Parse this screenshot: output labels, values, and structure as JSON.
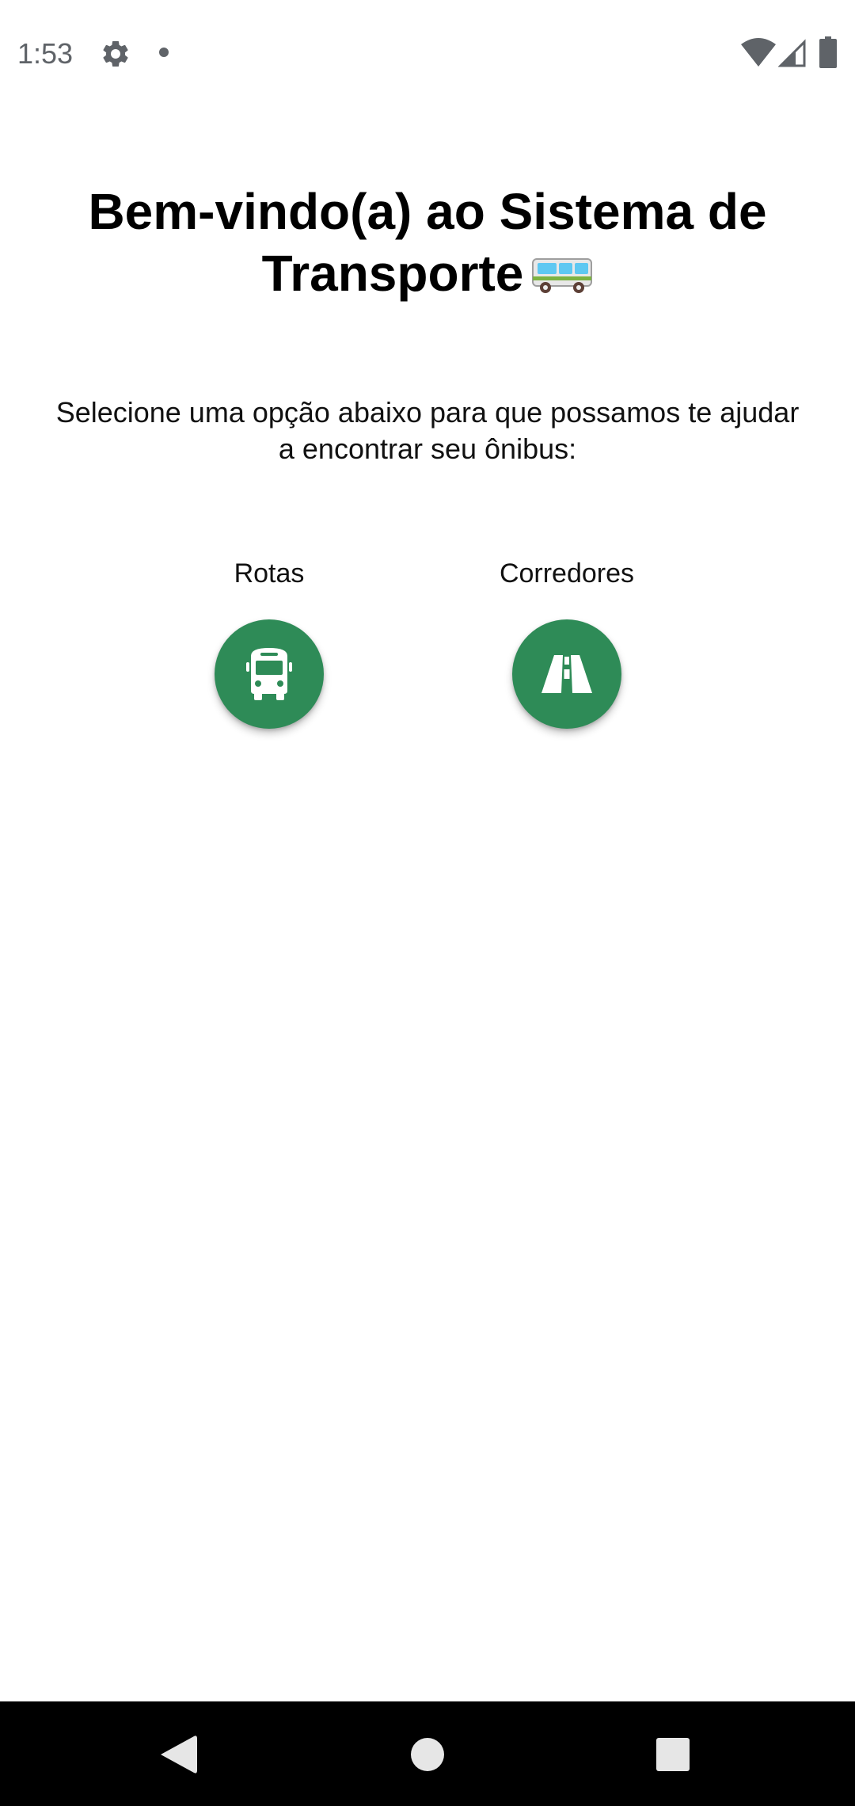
{
  "status_bar": {
    "time": "1:53",
    "icons": [
      "gear-icon",
      "notification-dot-icon",
      "wifi-icon",
      "cell-signal-icon",
      "battery-icon"
    ],
    "icon_color": "#5f6368"
  },
  "header": {
    "title": "Bem-vindo(a) ao Sistema de Transporte"
  },
  "intro": {
    "text": "Selecione uma opção abaixo para que possamos te ajudar a encontrar seu ônibus:"
  },
  "options": [
    {
      "label": "Rotas",
      "icon": "bus-icon"
    },
    {
      "label": "Corredores",
      "icon": "road-icon"
    }
  ],
  "colors": {
    "accent": "#2e8b57",
    "background": "#ffffff",
    "nav_bar": "#000000"
  },
  "nav_bar": {
    "buttons": [
      "back",
      "home",
      "recents"
    ]
  }
}
